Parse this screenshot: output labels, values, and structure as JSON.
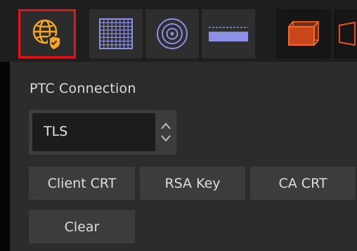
{
  "toolbar": {
    "tools": [
      {
        "icon": "globe-shield-icon",
        "active": true
      },
      {
        "icon": "grid-icon"
      },
      {
        "icon": "concentric-circles-icon"
      },
      {
        "icon": "plane-icon"
      },
      {
        "icon": "orange-box-icon"
      },
      {
        "icon": "orange-frame-icon"
      }
    ]
  },
  "panel": {
    "title": "PTC Connection",
    "protocol_select": {
      "value": "TLS"
    },
    "buttons": {
      "client_crt": "Client CRT",
      "rsa_key": "RSA Key",
      "ca_crt": "CA CRT",
      "clear": "Clear"
    }
  },
  "colors": {
    "accent_orange": "#f5a623",
    "active_border": "#e5141c",
    "lavender": "#8b8fe6",
    "box_orange": "#e0541c"
  }
}
